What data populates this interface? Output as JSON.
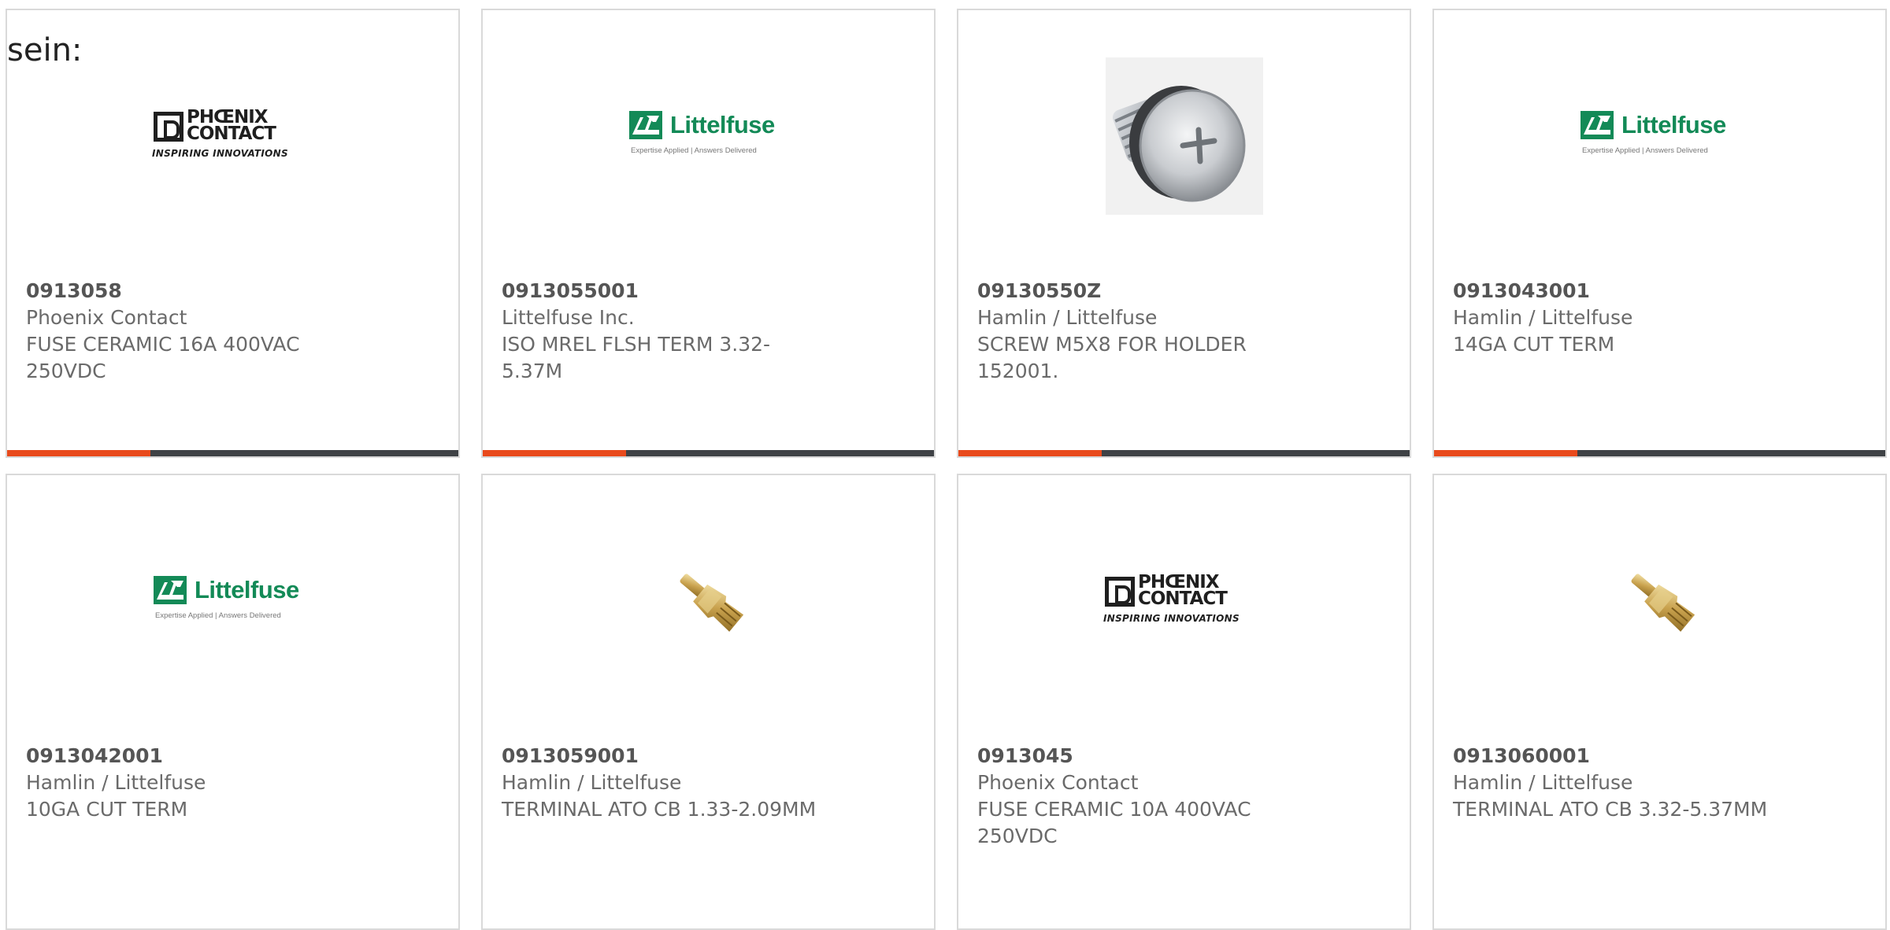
{
  "intro_text": "sein:",
  "colors": {
    "accent": "#e84a1c",
    "bar": "#3f4246",
    "border": "#d9d9d9",
    "part_number": "#555555",
    "body_text": "#6a6a6a",
    "littelfuse_green": "#138a57"
  },
  "logos": {
    "phoenix": {
      "line1": "PHŒNIX",
      "line2": "CONTACT",
      "tagline": "INSPIRING INNOVATIONS"
    },
    "littelfuse": {
      "name": "Littelfuse",
      "tagline": "Expertise Applied | Answers Delivered"
    }
  },
  "products": [
    {
      "part_number": "0913058",
      "manufacturer": "Phoenix Contact",
      "description_line1": "FUSE CERAMIC 16A 400VAC",
      "description_line2": "250VDC",
      "image": "phoenix-contact-logo"
    },
    {
      "part_number": "0913055001",
      "manufacturer": "Littelfuse Inc.",
      "description_line1": "ISO MREL FLSH TERM 3.32-",
      "description_line2": "5.37M",
      "image": "littelfuse-logo"
    },
    {
      "part_number": "09130550Z",
      "manufacturer": "Hamlin / Littelfuse",
      "description_line1": "SCREW M5X8 FOR HOLDER",
      "description_line2": "152001.",
      "image": "screw-photo"
    },
    {
      "part_number": "0913043001",
      "manufacturer": "Hamlin / Littelfuse",
      "description_line1": "14GA CUT TERM",
      "description_line2": "",
      "image": "littelfuse-logo"
    },
    {
      "part_number": "0913042001",
      "manufacturer": "Hamlin / Littelfuse",
      "description_line1": "10GA CUT TERM",
      "description_line2": "",
      "image": "littelfuse-logo"
    },
    {
      "part_number": "0913059001",
      "manufacturer": "Hamlin / Littelfuse",
      "description_line1": "TERMINAL ATO CB 1.33-2.09MM",
      "description_line2": "",
      "image": "terminal-photo"
    },
    {
      "part_number": "0913045",
      "manufacturer": "Phoenix Contact",
      "description_line1": "FUSE CERAMIC 10A 400VAC",
      "description_line2": "250VDC",
      "image": "phoenix-contact-logo"
    },
    {
      "part_number": "0913060001",
      "manufacturer": "Hamlin / Littelfuse",
      "description_line1": "TERMINAL ATO CB 3.32-5.37MM",
      "description_line2": "",
      "image": "terminal-photo"
    }
  ]
}
